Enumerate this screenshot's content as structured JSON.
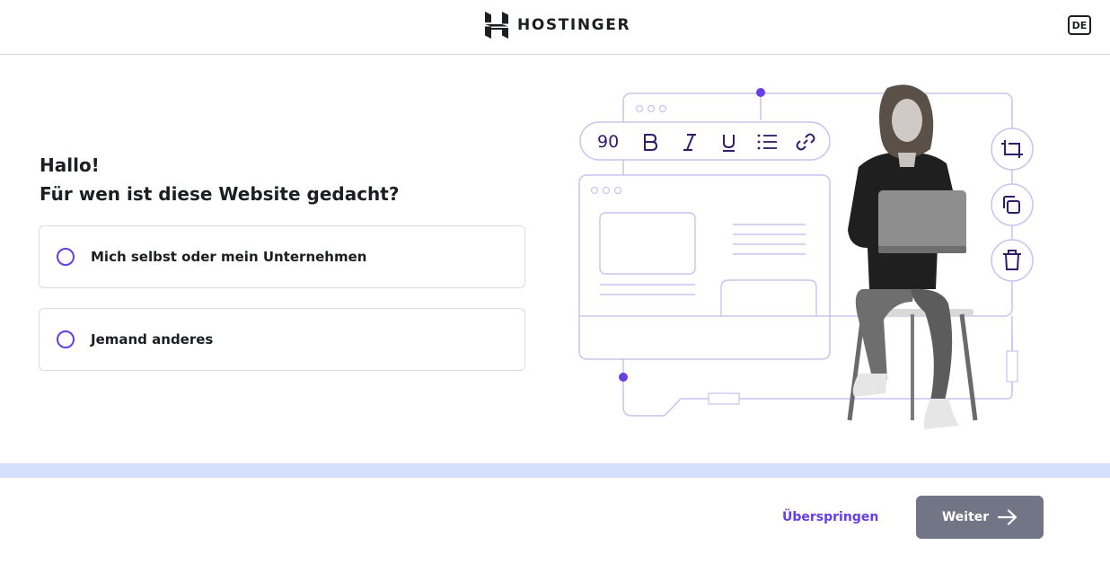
{
  "header": {
    "brand": "HOSTINGER",
    "logo_icon": "hostinger-h-icon",
    "language": "DE"
  },
  "main": {
    "greeting": "Hallo!",
    "question": "Für wen ist diese Website gedacht?",
    "options": [
      {
        "label": "Mich selbst oder mein Unternehmen",
        "selected": false
      },
      {
        "label": "Jemand anderes",
        "selected": false
      }
    ]
  },
  "illustration": {
    "toolbar_value": "90",
    "toolbar_icons": [
      "bold-icon",
      "italic-icon",
      "underline-icon",
      "list-icon",
      "link-icon"
    ],
    "side_icons": [
      "crop-icon",
      "copy-icon",
      "trash-icon"
    ]
  },
  "progress": {
    "fraction": 0
  },
  "footer": {
    "skip_label": "Überspringen",
    "next_label": "Weiter",
    "next_icon": "arrow-right-icon"
  },
  "colors": {
    "accent": "#673de6",
    "progress_track": "#d5dfff",
    "button_disabled": "#727586",
    "text": "#1d1e20"
  }
}
